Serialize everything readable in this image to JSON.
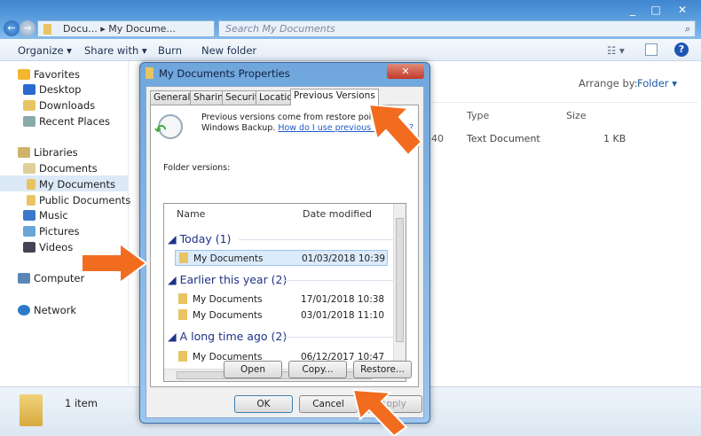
{
  "explorer": {
    "address": {
      "parent": "Docu...",
      "current": "My Docume..."
    },
    "search_placeholder": "Search My Documents",
    "toolbar": {
      "organize": "Organize",
      "share_with": "Share with",
      "burn": "Burn",
      "new_folder": "New folder"
    },
    "nav": {
      "favorites": "Favorites",
      "desktop": "Desktop",
      "downloads": "Downloads",
      "recent": "Recent Places",
      "libraries": "Libraries",
      "documents": "Documents",
      "my_documents": "My Documents",
      "public_documents": "Public Documents",
      "music": "Music",
      "pictures": "Pictures",
      "videos": "Videos",
      "computer": "Computer",
      "network": "Network"
    },
    "arrange_by_label": "Arrange by:",
    "arrange_by_value": "Folder",
    "columns": {
      "type": "Type",
      "size": "Size"
    },
    "file": {
      "date_fragment": "40",
      "type": "Text Document",
      "size": "1 KB"
    },
    "status": "1 item"
  },
  "dialog": {
    "title": "My Documents Properties",
    "tabs": [
      "General",
      "Sharing",
      "Security",
      "Location",
      "Previous Versions"
    ],
    "info_line1": "Previous versions come from restore points",
    "info_line2": "Windows Backup.",
    "info_link": "How do I use previous versions?",
    "folder_versions_label": "Folder versions:",
    "columns": {
      "name": "Name",
      "date": "Date modified"
    },
    "groups": [
      {
        "label": "Today (1)",
        "items": [
          {
            "name": "My Documents",
            "date": "01/03/2018 10:39"
          }
        ]
      },
      {
        "label": "Earlier this year (2)",
        "items": [
          {
            "name": "My Documents",
            "date": "17/01/2018 10:38"
          },
          {
            "name": "My Documents",
            "date": "03/01/2018 11:10"
          }
        ]
      },
      {
        "label": "A long time ago (2)",
        "items": [
          {
            "name": "My Documents",
            "date": "06/12/2017 10:47"
          }
        ]
      }
    ],
    "buttons": {
      "open": "Open",
      "copy": "Copy...",
      "restore": "Restore...",
      "ok": "OK",
      "cancel": "Cancel",
      "apply": "Apply"
    }
  },
  "colors": {
    "arrow": "#f26c1f",
    "accent": "#1e3287"
  }
}
